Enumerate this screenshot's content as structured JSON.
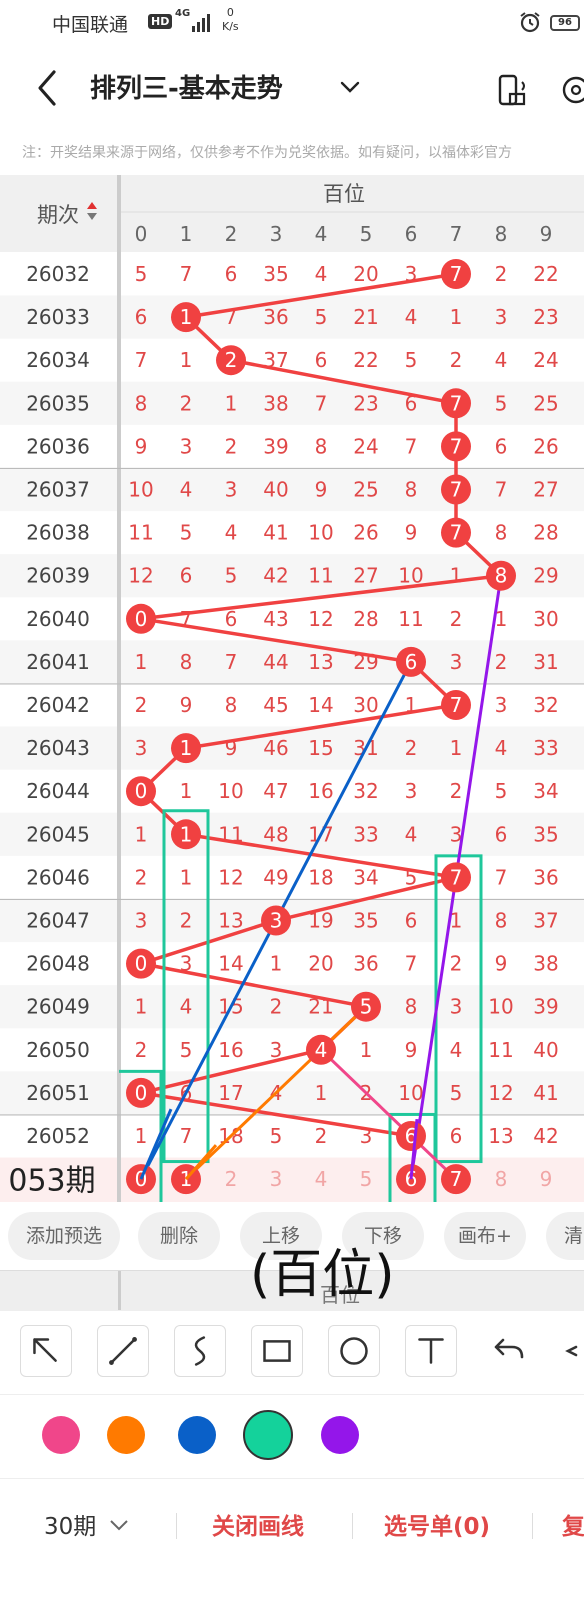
{
  "status_bar": {
    "carrier": "中国联通",
    "hd": "HD",
    "network": "4G",
    "speed_value": "0",
    "speed_unit": "K/s",
    "battery": "96"
  },
  "header": {
    "title": "排列三-基本走势"
  },
  "notice": "注：开奖结果来源于网络，仅供参考不作为兑奖依据。如有疑问，以福体彩官方",
  "table": {
    "period_header": "期次",
    "group_header": "百位",
    "digits": [
      "0",
      "1",
      "2",
      "3",
      "4",
      "5",
      "6",
      "7",
      "8",
      "9"
    ],
    "rows": [
      {
        "period": "26032",
        "cells": [
          "5",
          "7",
          "6",
          "35",
          "4",
          "20",
          "3",
          "7",
          "2",
          "22"
        ],
        "hit": 7
      },
      {
        "period": "26033",
        "cells": [
          "6",
          "1",
          "7",
          "36",
          "5",
          "21",
          "4",
          "1",
          "3",
          "23"
        ],
        "hit": 1
      },
      {
        "period": "26034",
        "cells": [
          "7",
          "1",
          "2",
          "37",
          "6",
          "22",
          "5",
          "2",
          "4",
          "24"
        ],
        "hit": 2
      },
      {
        "period": "26035",
        "cells": [
          "8",
          "2",
          "1",
          "38",
          "7",
          "23",
          "6",
          "7",
          "5",
          "25"
        ],
        "hit": 7
      },
      {
        "period": "26036",
        "cells": [
          "9",
          "3",
          "2",
          "39",
          "8",
          "24",
          "7",
          "7",
          "6",
          "26"
        ],
        "hit": 7
      },
      {
        "period": "26037",
        "cells": [
          "10",
          "4",
          "3",
          "40",
          "9",
          "25",
          "8",
          "7",
          "7",
          "27"
        ],
        "hit": 7
      },
      {
        "period": "26038",
        "cells": [
          "11",
          "5",
          "4",
          "41",
          "10",
          "26",
          "9",
          "7",
          "8",
          "28"
        ],
        "hit": 7
      },
      {
        "period": "26039",
        "cells": [
          "12",
          "6",
          "5",
          "42",
          "11",
          "27",
          "10",
          "1",
          "8",
          "29"
        ],
        "hit": 8
      },
      {
        "period": "26040",
        "cells": [
          "0",
          "7",
          "6",
          "43",
          "12",
          "28",
          "11",
          "2",
          "1",
          "30"
        ],
        "hit": 0
      },
      {
        "period": "26041",
        "cells": [
          "1",
          "8",
          "7",
          "44",
          "13",
          "29",
          "6",
          "3",
          "2",
          "31"
        ],
        "hit": 6
      },
      {
        "period": "26042",
        "cells": [
          "2",
          "9",
          "8",
          "45",
          "14",
          "30",
          "1",
          "7",
          "3",
          "32"
        ],
        "hit": 7
      },
      {
        "period": "26043",
        "cells": [
          "3",
          "1",
          "9",
          "46",
          "15",
          "31",
          "2",
          "1",
          "4",
          "33"
        ],
        "hit": 1
      },
      {
        "period": "26044",
        "cells": [
          "0",
          "1",
          "10",
          "47",
          "16",
          "32",
          "3",
          "2",
          "5",
          "34"
        ],
        "hit": 0
      },
      {
        "period": "26045",
        "cells": [
          "1",
          "1",
          "11",
          "48",
          "17",
          "33",
          "4",
          "3",
          "6",
          "35"
        ],
        "hit": 1
      },
      {
        "period": "26046",
        "cells": [
          "2",
          "1",
          "12",
          "49",
          "18",
          "34",
          "5",
          "7",
          "7",
          "36"
        ],
        "hit": 7
      },
      {
        "period": "26047",
        "cells": [
          "3",
          "2",
          "13",
          "3",
          "19",
          "35",
          "6",
          "1",
          "8",
          "37"
        ],
        "hit": 3
      },
      {
        "period": "26048",
        "cells": [
          "0",
          "3",
          "14",
          "1",
          "20",
          "36",
          "7",
          "2",
          "9",
          "38"
        ],
        "hit": 0
      },
      {
        "period": "26049",
        "cells": [
          "1",
          "4",
          "15",
          "2",
          "21",
          "5",
          "8",
          "3",
          "10",
          "39"
        ],
        "hit": 5
      },
      {
        "period": "26050",
        "cells": [
          "2",
          "5",
          "16",
          "3",
          "4",
          "1",
          "9",
          "4",
          "11",
          "40"
        ],
        "hit": 4
      },
      {
        "period": "26051",
        "cells": [
          "0",
          "6",
          "17",
          "4",
          "1",
          "2",
          "10",
          "5",
          "12",
          "41"
        ],
        "hit": 0
      },
      {
        "period": "26052",
        "cells": [
          "1",
          "7",
          "18",
          "5",
          "2",
          "3",
          "6",
          "6",
          "13",
          "42"
        ],
        "hit": 6
      }
    ],
    "next_period_label": "053期",
    "preselect_cells": [
      "0",
      "1",
      "2",
      "3",
      "4",
      "5",
      "6",
      "7",
      "8",
      "9"
    ],
    "preselect_marked": [
      0,
      1,
      6,
      7
    ]
  },
  "action_bar": {
    "buttons": [
      "添加预选",
      "删除",
      "上移",
      "下移",
      "画布+",
      "清"
    ]
  },
  "sub_header": "百位",
  "overlay_annotation": "(百位)",
  "tools": [
    "arrow",
    "line",
    "curve",
    "rectangle",
    "circle",
    "text",
    "undo",
    "redo"
  ],
  "palette": {
    "colors": [
      "#f0468a",
      "#ff7a00",
      "#0a60c8",
      "#14d29b",
      "#9416ea"
    ],
    "selected_index": 3
  },
  "footer": {
    "periods": "30期",
    "close_drawing": "关闭画线",
    "selection": "选号单(0)",
    "more": "复"
  },
  "theme": {
    "hit_red": "#f04141",
    "number_red": "#e04848",
    "rect_green": "#1fc79b"
  }
}
